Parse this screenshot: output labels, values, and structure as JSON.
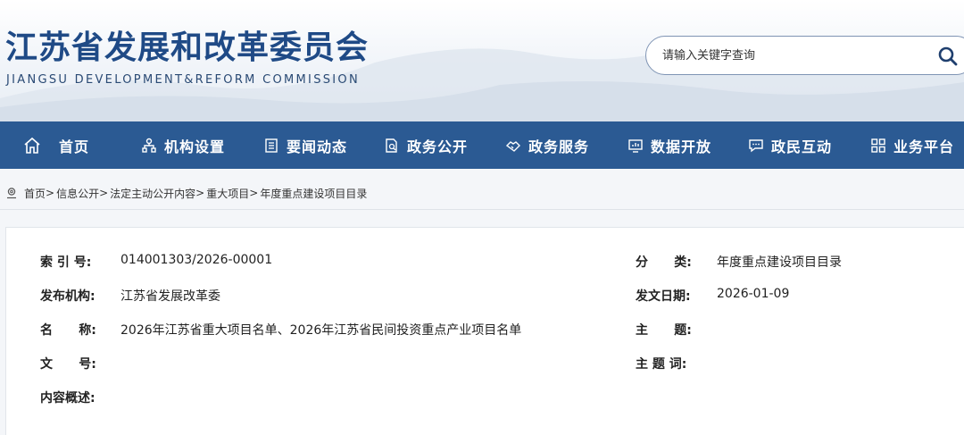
{
  "header": {
    "title": "江苏省发展和改革委员会",
    "subtitle": "JIANGSU DEVELOPMENT&REFORM COMMISSION"
  },
  "search": {
    "placeholder": "请输入关键字查询",
    "value": "",
    "icon": "search-icon"
  },
  "nav": {
    "items": [
      {
        "label": "首页",
        "icon": "home-icon"
      },
      {
        "label": "机构设置",
        "icon": "org-chart-icon"
      },
      {
        "label": "要闻动态",
        "icon": "newspaper-icon"
      },
      {
        "label": "政务公开",
        "icon": "document-search-icon"
      },
      {
        "label": "政务服务",
        "icon": "handshake-icon"
      },
      {
        "label": "数据开放",
        "icon": "data-monitor-icon"
      },
      {
        "label": "政民互动",
        "icon": "chat-icon"
      },
      {
        "label": "业务平台",
        "icon": "grid-icon"
      }
    ]
  },
  "breadcrumb": {
    "items": [
      "首页",
      "信息公开",
      "法定主动公开内容",
      "重大项目",
      "年度重点建设项目目录"
    ],
    "separator": ">"
  },
  "info": {
    "index_label": "索 引 号:",
    "index_value": "014001303/2026-00001",
    "category_label": "分      类:",
    "category_value": "年度重点建设项目目录",
    "publisher_label": "发布机构:",
    "publisher_value": "江苏省发展改革委",
    "date_label": "发文日期:",
    "date_value": "2026-01-09",
    "name_label": "名      称:",
    "name_value": "2026年江苏省重大项目名单、2026年江苏省民间投资重点产业项目名单",
    "subject_label": "主      题:",
    "subject_value": "",
    "docno_label": "文      号:",
    "docno_value": "",
    "keywords_label": "主 题 词:",
    "keywords_value": "",
    "summary_label": "内容概述:",
    "summary_value": ""
  },
  "colors": {
    "nav_bg": "#2b5a93",
    "title": "#1f4a86"
  }
}
